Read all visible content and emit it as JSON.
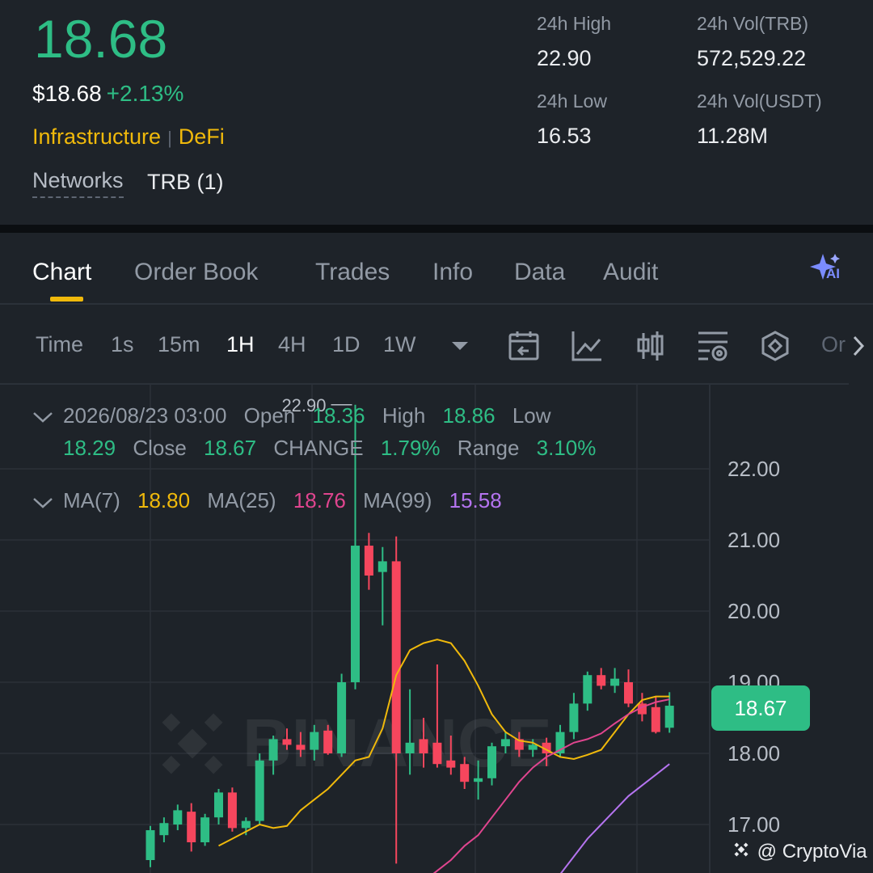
{
  "header": {
    "last_price": "18.68",
    "usd_price": "$18.68",
    "change_pct": "+2.13%",
    "tags": [
      "Infrastructure",
      "DeFi"
    ],
    "tag_separator": "|",
    "networks_label": "Networks",
    "networks_value": "TRB (1)",
    "stats": {
      "high_label": "24h High",
      "high_value": "22.90",
      "low_label": "24h Low",
      "low_value": "16.53",
      "vol_base_label": "24h Vol(TRB)",
      "vol_base_value": "572,529.22",
      "vol_quote_label": "24h Vol(USDT)",
      "vol_quote_value": "11.28M"
    }
  },
  "tabs": [
    "Chart",
    "Order Book",
    "Trades",
    "Info",
    "Data",
    "Audit"
  ],
  "active_tab": "Chart",
  "toolbar": {
    "time_label": "Time",
    "intervals": [
      "1s",
      "15m",
      "1H",
      "4H",
      "1D",
      "1W"
    ],
    "active_interval": "1H",
    "more_label": "Or",
    "icons": [
      "chevron-down-icon",
      "calendar-back-icon",
      "line-chart-icon",
      "candlestick-icon",
      "indicator-settings-icon",
      "hexagon-icon",
      "chevron-right-icon",
      "ai-sparkle-icon"
    ],
    "ai_badge": "AI"
  },
  "ohlc": {
    "datetime": "2026/08/23 03:00",
    "open_label": "Open",
    "open": "18.36",
    "high_label": "High",
    "high": "18.86",
    "low_label": "Low",
    "low": "18.29",
    "close_label": "Close",
    "close": "18.67",
    "change_label": "CHANGE",
    "change": "1.79%",
    "range_label": "Range",
    "range": "3.10%"
  },
  "ma": {
    "ma7_label": "MA(7)",
    "ma7": "18.80",
    "ma25_label": "MA(25)",
    "ma25": "18.76",
    "ma99_label": "MA(99)",
    "ma99": "15.58"
  },
  "colors": {
    "up": "#2ebd85",
    "down": "#f6465d",
    "ma7": "#f0b90b",
    "ma25": "#e0458f",
    "ma99": "#b574f0",
    "accent": "#f0b90b"
  },
  "chart_data": {
    "type": "candlestick",
    "y_ticks": [
      "22.00",
      "21.00",
      "20.00",
      "19.00",
      "18.00",
      "17.00"
    ],
    "ylim": [
      16.5,
      23.0
    ],
    "max_marker": "22.90",
    "current_price_tag": "18.67",
    "candles": [
      {
        "o": 16.5,
        "h": 16.98,
        "l": 16.4,
        "c": 16.92
      },
      {
        "o": 16.85,
        "h": 17.1,
        "l": 16.75,
        "c": 17.02
      },
      {
        "o": 17.0,
        "h": 17.28,
        "l": 16.92,
        "c": 17.2
      },
      {
        "o": 17.18,
        "h": 17.3,
        "l": 16.62,
        "c": 16.75
      },
      {
        "o": 16.75,
        "h": 17.15,
        "l": 16.7,
        "c": 17.1
      },
      {
        "o": 17.1,
        "h": 17.5,
        "l": 17.0,
        "c": 17.45
      },
      {
        "o": 17.45,
        "h": 17.52,
        "l": 16.9,
        "c": 16.95
      },
      {
        "o": 16.95,
        "h": 17.1,
        "l": 16.85,
        "c": 17.05
      },
      {
        "o": 17.05,
        "h": 18.0,
        "l": 17.0,
        "c": 17.9
      },
      {
        "o": 17.9,
        "h": 18.25,
        "l": 17.7,
        "c": 18.2
      },
      {
        "o": 18.2,
        "h": 18.35,
        "l": 18.05,
        "c": 18.12
      },
      {
        "o": 18.12,
        "h": 18.3,
        "l": 17.95,
        "c": 18.05
      },
      {
        "o": 18.05,
        "h": 18.4,
        "l": 17.9,
        "c": 18.3
      },
      {
        "o": 18.32,
        "h": 18.4,
        "l": 17.98,
        "c": 18.0
      },
      {
        "o": 18.0,
        "h": 19.12,
        "l": 17.95,
        "c": 19.0
      },
      {
        "o": 19.0,
        "h": 22.9,
        "l": 18.9,
        "c": 20.92
      },
      {
        "o": 20.92,
        "h": 21.1,
        "l": 20.3,
        "c": 20.5
      },
      {
        "o": 20.55,
        "h": 20.9,
        "l": 19.8,
        "c": 20.7
      },
      {
        "o": 20.7,
        "h": 21.05,
        "l": 16.45,
        "c": 18.0
      },
      {
        "o": 18.0,
        "h": 18.9,
        "l": 17.7,
        "c": 18.15
      },
      {
        "o": 18.2,
        "h": 18.5,
        "l": 17.8,
        "c": 18.0
      },
      {
        "o": 18.15,
        "h": 19.25,
        "l": 17.8,
        "c": 17.85
      },
      {
        "o": 17.9,
        "h": 18.25,
        "l": 17.7,
        "c": 17.8
      },
      {
        "o": 17.85,
        "h": 17.95,
        "l": 17.5,
        "c": 17.6
      },
      {
        "o": 17.6,
        "h": 17.9,
        "l": 17.35,
        "c": 17.65
      },
      {
        "o": 17.65,
        "h": 18.15,
        "l": 17.55,
        "c": 18.1
      },
      {
        "o": 18.1,
        "h": 18.3,
        "l": 18.0,
        "c": 18.2
      },
      {
        "o": 18.2,
        "h": 18.3,
        "l": 17.95,
        "c": 18.05
      },
      {
        "o": 18.05,
        "h": 18.2,
        "l": 17.95,
        "c": 18.12
      },
      {
        "o": 18.15,
        "h": 18.22,
        "l": 17.82,
        "c": 18.0
      },
      {
        "o": 18.0,
        "h": 18.4,
        "l": 17.95,
        "c": 18.3
      },
      {
        "o": 18.3,
        "h": 18.85,
        "l": 18.2,
        "c": 18.7
      },
      {
        "o": 18.7,
        "h": 19.15,
        "l": 18.6,
        "c": 19.1
      },
      {
        "o": 19.1,
        "h": 19.2,
        "l": 18.9,
        "c": 18.95
      },
      {
        "o": 18.95,
        "h": 19.2,
        "l": 18.85,
        "c": 19.05
      },
      {
        "o": 19.0,
        "h": 19.18,
        "l": 18.65,
        "c": 18.7
      },
      {
        "o": 18.7,
        "h": 18.85,
        "l": 18.45,
        "c": 18.55
      },
      {
        "o": 18.65,
        "h": 18.8,
        "l": 18.28,
        "c": 18.3
      },
      {
        "o": 18.36,
        "h": 18.86,
        "l": 18.29,
        "c": 18.67
      }
    ],
    "ma7": [
      16.7,
      16.8,
      16.9,
      17.0,
      16.95,
      16.98,
      17.2,
      17.35,
      17.5,
      17.7,
      17.9,
      17.95,
      18.35,
      19.1,
      19.45,
      19.55,
      19.6,
      19.55,
      19.3,
      18.95,
      18.55,
      18.3,
      18.18,
      18.15,
      18.05,
      17.95,
      17.92,
      17.98,
      18.05,
      18.3,
      18.55,
      18.75,
      18.8,
      18.8
    ],
    "ma25": [
      16.2,
      16.35,
      16.5,
      16.7,
      16.85,
      17.1,
      17.35,
      17.6,
      17.8,
      17.95,
      18.05,
      18.15,
      18.2,
      18.28,
      18.42,
      18.55,
      18.65,
      18.72,
      18.76
    ],
    "ma99": [
      16.0,
      16.3,
      16.55,
      16.8,
      17.0,
      17.2,
      17.4,
      17.55,
      17.7,
      17.85
    ]
  },
  "watermark": "@ CryptoVia",
  "logo_watermark": "BINANCE"
}
